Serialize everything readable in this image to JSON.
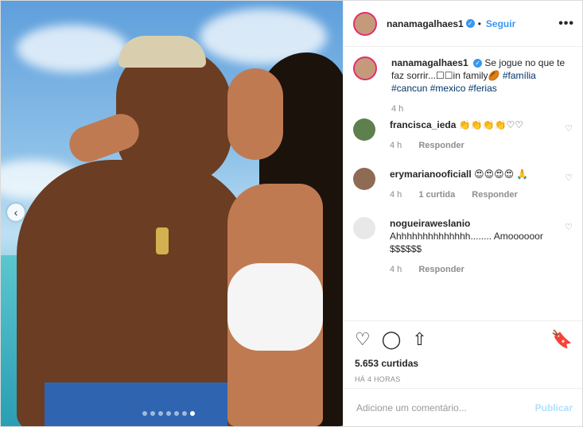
{
  "header": {
    "username": "nanamagalhaes1",
    "follow_label": "Seguir",
    "more_label": "•••"
  },
  "caption": {
    "username": "nanamagalhaes1",
    "text": "Se jogue no que te faz sorrir...☐☐in family🏉",
    "hashtags": [
      "#família",
      "#cancun",
      "#mexico",
      "#ferias"
    ],
    "time": "4 h"
  },
  "comments": [
    {
      "username": "francisca_ieda",
      "text": "👏👏👏👏♡♡",
      "time": "4 h",
      "likes": "",
      "reply": "Responder"
    },
    {
      "username": "erymarianooficiall",
      "text": "😍😍😍😍 🙏",
      "time": "4 h",
      "likes": "1 curtida",
      "reply": "Responder"
    },
    {
      "username": "nogueiraweslanio",
      "text": "Ahhhhhhhhhhhhhh........ Amoooooor $$$$$$",
      "time": "4 h",
      "likes": "",
      "reply": "Responder"
    }
  ],
  "actions": {
    "likes": "5.653 curtidas",
    "ago": "HÁ 4 HORAS"
  },
  "add_comment": {
    "placeholder": "Adicione um comentário...",
    "publish_label": "Publicar"
  },
  "carousel": {
    "count": 7,
    "active": 6
  },
  "icons": {
    "verified": "verified-badge-icon",
    "like": "heart-icon",
    "comment": "comment-icon",
    "share": "share-icon",
    "save": "bookmark-icon"
  },
  "colors": {
    "link": "#3897f0",
    "hashtag": "#003569",
    "publish_disabled": "#b2dffc"
  }
}
